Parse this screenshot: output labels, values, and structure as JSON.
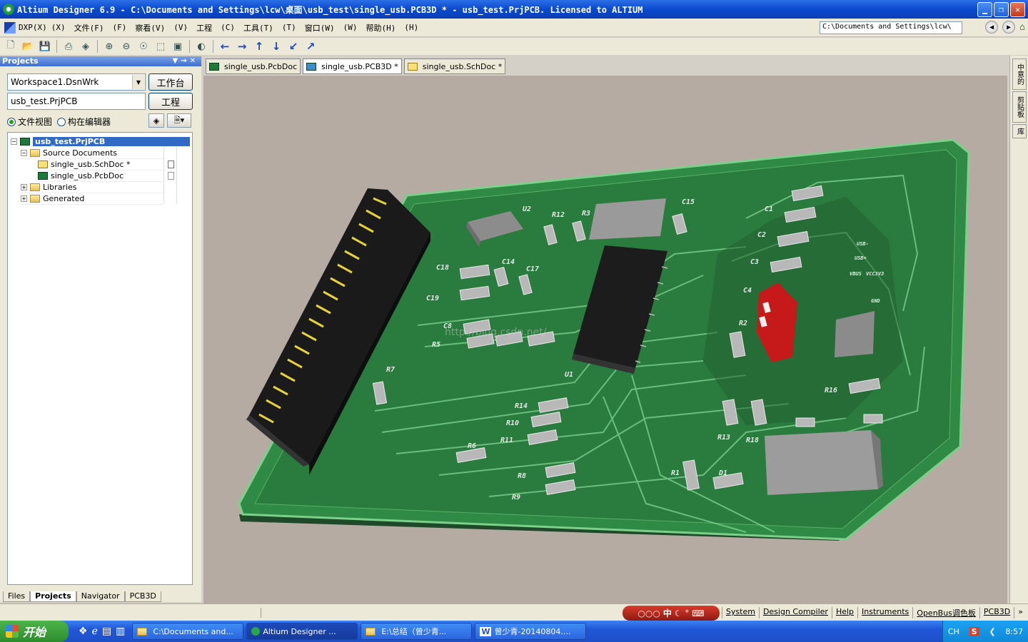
{
  "window": {
    "title": "Altium Designer 6.9 - C:\\Documents and Settings\\lcw\\桌面\\usb_test\\single_usb.PCB3D * - usb_test.PrjPCB. Licensed to ALTIUM"
  },
  "menubar": {
    "items": [
      "DXP(X)",
      "(X)",
      "文件(F)",
      "(F)",
      "察看(V)",
      "(V)",
      "工程",
      "(C)",
      "工具(T)",
      "(T)",
      "窗口(W)",
      "(W)",
      "帮助(H)",
      "(H)"
    ],
    "path": "C:\\Documents and Settings\\lcw\\"
  },
  "projects_panel": {
    "title": "Projects",
    "workspace": "Workspace1.DsnWrk",
    "workspace_btn": "工作台",
    "project": "usb_test.PrjPCB",
    "project_btn": "工程",
    "radio_file_view": "文件视图",
    "radio_structure": "构在编辑器",
    "tree": {
      "root": "usb_test.PrjPCB",
      "source_folder": "Source Documents",
      "files": [
        "single_usb.SchDoc *",
        "single_usb.PcbDoc"
      ],
      "libraries": "Libraries",
      "generated": "Generated"
    },
    "bottom_tabs": [
      "Files",
      "Projects",
      "Navigator",
      "PCB3D"
    ]
  },
  "doc_tabs": [
    "single_usb.PcbDoc",
    "single_usb.PCB3D *",
    "single_usb.SchDoc *"
  ],
  "right_rail": [
    "中意的",
    "剪贴板",
    "库"
  ],
  "pcb": {
    "labels": [
      "U2",
      "R12",
      "R3",
      "C15",
      "U1",
      "C18",
      "C14",
      "C17",
      "C19",
      "C8",
      "R5",
      "R7",
      "R14",
      "R10",
      "R11",
      "R6",
      "R8",
      "R9",
      "R2",
      "R16",
      "R13",
      "R18",
      "R1",
      "D1",
      "C1",
      "C2",
      "C3",
      "C4",
      "GND",
      "USB-",
      "USB+",
      "VBUS",
      "VCC3V3"
    ],
    "watermark": "http://blog.csdn.net/"
  },
  "statusbar": {
    "ime": "中",
    "items": [
      "System",
      "Design Compiler",
      "Help",
      "Instruments",
      "OpenBus调色板",
      "PCB3D"
    ]
  },
  "taskbar": {
    "start": "开始",
    "tasks": [
      "C:\\Documents and...",
      "Altium Designer ...",
      "E:\\总结（曾少青...",
      "曾少青-20140804...."
    ],
    "lang": "CH",
    "clock": "8:57"
  }
}
